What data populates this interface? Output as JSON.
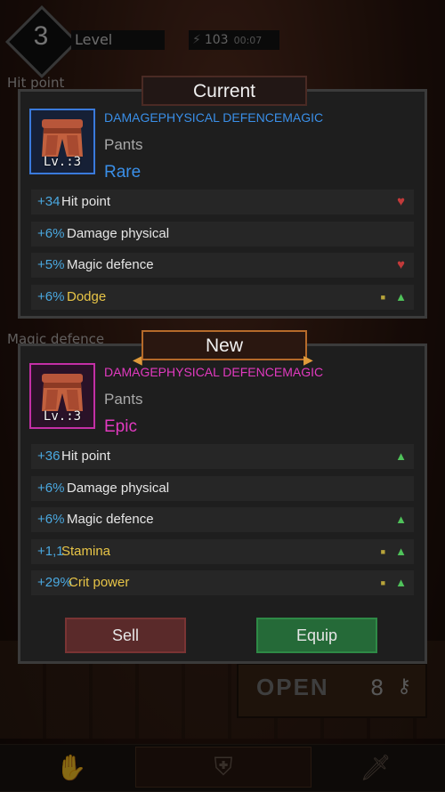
{
  "hud": {
    "level_number": "3",
    "level_label": "Level",
    "energy": "103",
    "timer": "00:07"
  },
  "background": {
    "hit_point_label": "Hit point",
    "magic_defence_label": "Magic defence",
    "chest": {
      "label": "OPEN",
      "count": "8"
    }
  },
  "current": {
    "title": "Current",
    "type_text": "DAMAGEPHYSICAL DEFENCEMAGIC",
    "name": "Pants",
    "rarity": "Rare",
    "level": "Lv.:3",
    "rarity_color": "#3a8fe8",
    "stats": [
      {
        "value": "+34",
        "name": "Hit point",
        "indicator": "heart"
      },
      {
        "value": "+6%",
        "name": "Damage physical",
        "indicator": ""
      },
      {
        "value": "+5%",
        "name": "Magic defence",
        "indicator": "heart"
      },
      {
        "value": "+6%",
        "name": "Dodge",
        "indicator": "up-square",
        "highlight": true
      }
    ]
  },
  "new": {
    "title": "New",
    "type_text": "DAMAGEPHYSICAL DEFENCEMAGIC",
    "name": "Pants",
    "rarity": "Epic",
    "level": "Lv.:3",
    "rarity_color": "#e23ac0",
    "stats": [
      {
        "value": "+36",
        "name": "Hit point",
        "indicator": "up"
      },
      {
        "value": "+6%",
        "name": "Damage physical",
        "indicator": ""
      },
      {
        "value": "+6%",
        "name": "Magic defence",
        "indicator": "up"
      },
      {
        "value": "+1,1",
        "name": "Stamina",
        "indicator": "up-square",
        "highlight": true
      },
      {
        "value": "+29%",
        "name": "Crit power",
        "indicator": "up-square",
        "highlight": true
      }
    ]
  },
  "buttons": {
    "sell": "Sell",
    "equip": "Equip"
  },
  "colors": {
    "stat_value": "#4aa8e0",
    "up": "#4fc25a",
    "down": "#c23a3a",
    "highlight": "#e8c547"
  }
}
